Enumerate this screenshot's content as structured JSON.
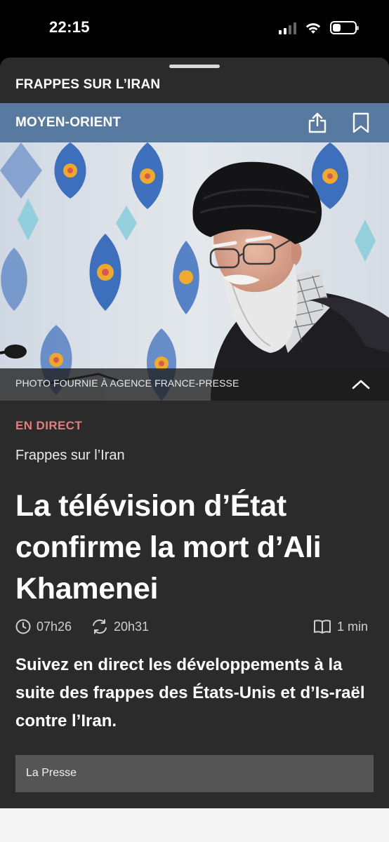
{
  "status_bar": {
    "time": "22:15",
    "icons": [
      "cellular-signal-icon",
      "wifi-icon",
      "battery-icon"
    ],
    "battery_level": 0.35
  },
  "sheet": {
    "header": "FRAPPES SUR L’IRAN",
    "section": "MOYEN-ORIENT",
    "actions": [
      "share-icon",
      "bookmark-icon"
    ]
  },
  "photo": {
    "caption": "PHOTO FOURNIE À AGENCE FRANCE-PRESSE",
    "toggle_icon": "chevron-up-icon"
  },
  "article": {
    "live_label": "EN DIRECT",
    "topic": "Frappes sur l’Iran",
    "headline": "La télévision d’État confirme la mort d’Ali Khamenei",
    "published_time": "07h26",
    "updated_time": "20h31",
    "read_time": "1 min",
    "lead": "Suivez en direct les développements à la suite des frappes des États-Unis et d’Is-raël contre l’Iran.",
    "source": "La Presse"
  },
  "colors": {
    "section_bar": "#587aa0",
    "live_label": "#e07f7f",
    "sheet_background": "#2b2b2b"
  }
}
